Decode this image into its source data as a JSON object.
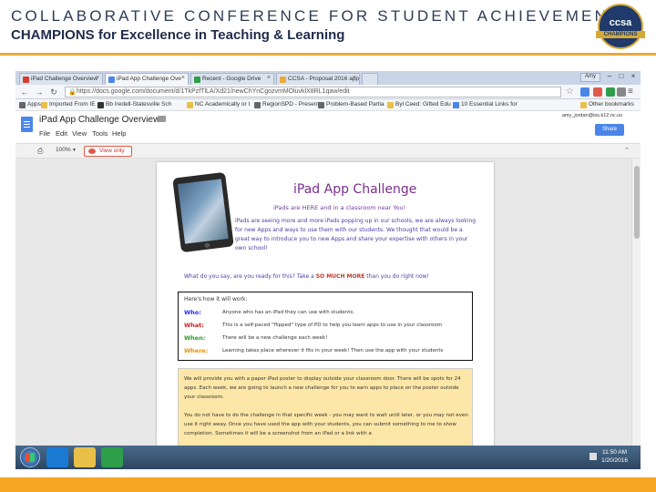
{
  "slide": {
    "header_line1": "COLLABORATIVE CONFERENCE FOR STUDENT ACHIEVEMENT",
    "header_line2": "CHAMPIONS for Excellence in Teaching & Learning",
    "logo_text": "ccsa",
    "logo_sub": "CHAMPIONS"
  },
  "browser": {
    "tabs": [
      {
        "label": "iPad Challenge Overview",
        "icon_color": "#d04030"
      },
      {
        "label": "iPad App Challenge Ove",
        "icon_color": "#4a86e8"
      },
      {
        "label": "Recent - Google Drive",
        "icon_color": "#2e9e4a"
      },
      {
        "label": "CCSA - Proposal 2016 app",
        "icon_color": "#e8a93a"
      }
    ],
    "user_chip": "Amy",
    "url": "https://docs.google.com/document/d/1TkPzfTlLA/Xd21/newChYnCgozvmMOluvklX8RL1qaw/edit",
    "bookmarks": [
      {
        "label": "Apps",
        "icon_color": "#666"
      },
      {
        "label": "Imported From IE",
        "icon_color": "#e8c048"
      },
      {
        "label": "Bb Iredell-Statesville Sch",
        "icon_color": "#333"
      },
      {
        "label": "NC Academically or I",
        "icon_color": "#e8c048"
      },
      {
        "label": "RegionSPD - Present",
        "icon_color": "#666"
      },
      {
        "label": "Problem-Based Partia",
        "icon_color": "#666"
      },
      {
        "label": "Byl Ceed: Gifted Edu",
        "icon_color": "#e8c048"
      },
      {
        "label": "10 Essential Links for",
        "icon_color": "#4a86e8"
      }
    ],
    "other_bookmarks": "Other bookmarks"
  },
  "docs": {
    "title": "iPad App Challenge Overview",
    "menus": [
      "File",
      "Edit",
      "View",
      "Tools",
      "Help"
    ],
    "user_email": "amy_jordan@iss.k12.nc.us",
    "share_label": "Share",
    "zoom": "100%",
    "view_only": "View only"
  },
  "document": {
    "heading": "iPad App Challenge",
    "subheading": "iPads are HERE and in a classroom near You!",
    "intro": "iPads are seeing more and more iPads popping up in our schools, we are always looking for new Apps and ways to use them with our students. We thought that would be a great way to introduce you to new Apps and share your expertise with others in your own school!",
    "tagline_a": "What do you say, are you ready for this?  Take a",
    "tagline_b": "SO MUCH MORE",
    "tagline_c": "than you do right now!",
    "box_title": "Here's how it will work:",
    "rows": [
      {
        "label": "Who:",
        "color": "#1a2eff",
        "desc": "Anyone who has an iPad they can use with students."
      },
      {
        "label": "What:",
        "color": "#d11a1a",
        "desc": "This is a self-paced \"flipped\" type of PD to help you learn apps to use in your classroom"
      },
      {
        "label": "When:",
        "color": "#2a9a2a",
        "desc": "There will be a new challenge each week!"
      },
      {
        "label": "Where:",
        "color": "#e8900a",
        "desc": "Learning takes place wherever it fits in your week! Then use the app with your students"
      }
    ],
    "box2_p1": "We will provide you with a paper iPad poster to display outside your classroom door. There will be spots for 24 apps. Each week, we are going to launch a new challenge for you to earn apps to place on the poster outside your classroom.",
    "box2_p2": "You do not have to do the challenge in that specific week - you may want to wait until later, or you may not even use it right away. Once you have used the app with your students, you can submit something to me to show completion. Sometimes it will be a screenshot from an iPad or a link with a"
  },
  "taskbar": {
    "time": "11:50 AM",
    "date": "1/20/2016",
    "icons": [
      {
        "name": "internet-explorer-icon",
        "color": "#1a7ad4"
      },
      {
        "name": "file-explorer-icon",
        "color": "#e8c048"
      },
      {
        "name": "chrome-icon",
        "color": "#2e9e4a"
      }
    ]
  }
}
